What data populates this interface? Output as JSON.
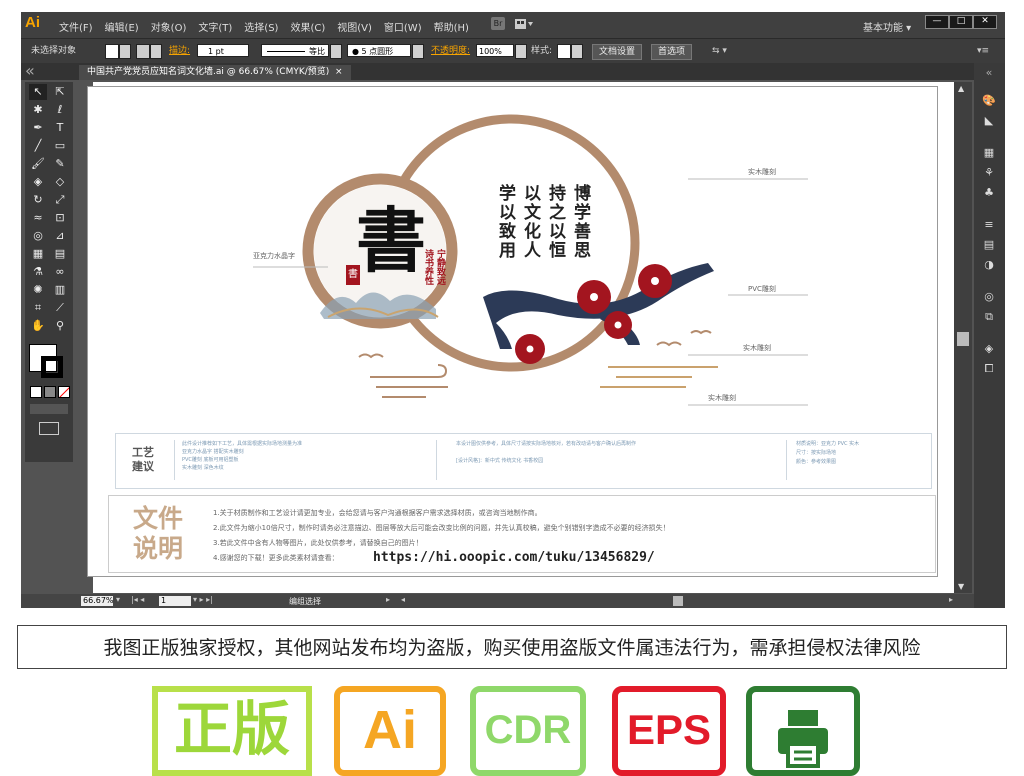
{
  "app": {
    "logo": "Ai",
    "menu": [
      "文件(F)",
      "编辑(E)",
      "对象(O)",
      "文字(T)",
      "选择(S)",
      "效果(C)",
      "视图(V)",
      "窗口(W)",
      "帮助(H)"
    ],
    "bridge": "Br",
    "workspace": "基本功能",
    "window_buttons": [
      "—",
      "□",
      "✕"
    ]
  },
  "control": {
    "selection": "未选择对象",
    "stroke_label": "描边:",
    "stroke_value": "1 pt",
    "profile": "等比",
    "brush": "5 点圆形",
    "opacity_label": "不透明度:",
    "opacity_value": "100%",
    "style_label": "样式:",
    "doc_setup": "文档设置",
    "prefs": "首选项"
  },
  "tab": {
    "title": "中国共产党党员应知名词文化墙.ai @ 66.67% (CMYK/预览)",
    "close": "×"
  },
  "status": {
    "zoom": "66.67%",
    "page": "1",
    "mode": "编组选择"
  },
  "artwork": {
    "big_char": "書",
    "seal_text": "書",
    "poem_cols": [
      "宁静致远",
      "诗书养性"
    ],
    "verse_cols": [
      "博学善思",
      "持之以恒",
      "以文化人",
      "学以致用"
    ],
    "labels": {
      "acrylic": "亚克力水晶字",
      "wood1": "实木雕刻",
      "pvc": "PVC雕刻",
      "wood2": "实木雕刻",
      "wood3": "实木雕刻"
    },
    "craft": {
      "title": "工艺建议",
      "col1": [
        "此件设计推荐如下工艺，具体需根据实际场地测量为准",
        "亚克力水晶字 搭配实木雕刻",
        "PVC雕刻 底板可用铝塑板",
        "实木雕刻 深色木纹"
      ],
      "col2": [
        "本设计图仅供参考，具体尺寸请按实际场地核对，若有改动请与客户确认后再制作",
        "[设计风格]：新中式 传统文化 书香校园"
      ],
      "col3": [
        "材质说明：亚克力 PVC 实木",
        "尺寸：按实际场地",
        "颜色：参考效果图"
      ]
    },
    "notes": {
      "title": "文件说明",
      "lines": [
        "1.关于材质制作和工艺设计请更加专业，会给您请与客户沟通根据客户需求选择材质，或咨询当地制作商。",
        "2.此文件为缩小10倍尺寸，制作时请务必注意描边、图层等放大后可能会改变比例的问题，并先认真校稿，避免个别错别字造成不必要的经济损失！",
        "3.若此文件中含有人物等图片，此处仅供参考，请替换自己的图片！",
        "4.感谢您的下载！更多此类素材请查看："
      ],
      "url": "https://hi.ooopic.com/tuku/13456829/"
    }
  },
  "warning": "我图正版独家授权，其他网站发布均为盗版，购买使用盗版文件属违法行为，需承担侵权法律风险",
  "badges": {
    "genuine": "正版",
    "ai": "Ai",
    "cdr": "CDR",
    "eps": "EPS",
    "print": "print-icon"
  },
  "colors": {
    "ai_orange": "#f7a400",
    "ring": "#b38b6d",
    "navy": "#2c3a57",
    "plum": "#a3151f",
    "gold": "#caa26d"
  }
}
